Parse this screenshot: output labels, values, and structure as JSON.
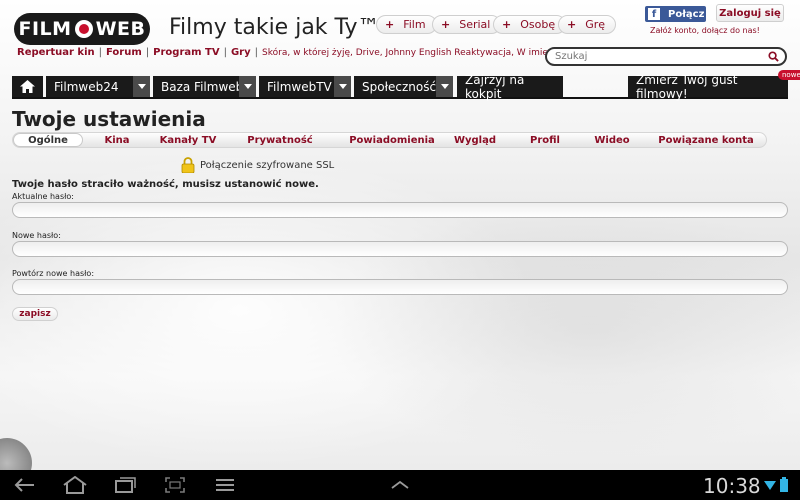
{
  "header": {
    "logo_text_left": "FILM",
    "logo_text_right": "WEB",
    "tagline": "Filmy takie jak Ty™",
    "add_buttons": [
      "Film",
      "Serial",
      "Osobę",
      "Grę"
    ],
    "facebook_label": "Połącz",
    "login_label": "Zaloguj się",
    "register_text": "Załóż konto, dołącz do nas!"
  },
  "quicklinks": {
    "items": [
      "Repertuar kin",
      "Forum",
      "Program TV",
      "Gry"
    ],
    "news": "Skóra, w której żyję, Drive, Johnny English Reaktywacja, W imieniu diabł..."
  },
  "search": {
    "placeholder": "Szukaj"
  },
  "nav": {
    "items": [
      "Filmweb24",
      "Baza Filmwebu",
      "FilmwebTV",
      "Społeczność",
      "Zajrzyj na kokpit"
    ],
    "promo": "Zmierz Twój gust filmowy!",
    "promo_badge": "nowe"
  },
  "settings": {
    "title": "Twoje ustawienia",
    "tabs": [
      "Ogólne",
      "Kina",
      "Kanały TV",
      "Prywatność",
      "Powiadomienia",
      "Wygląd",
      "Profil",
      "Wideo",
      "Powiązane konta"
    ],
    "active_tab": "Ogólne",
    "ssl_text": "Połączenie szyfrowane SSL",
    "warning": "Twoje hasło straciło ważność, musisz ustanowić nowe.",
    "fields": [
      {
        "label": "Aktualne hasło:",
        "value": ""
      },
      {
        "label": "Nowe hasło:",
        "value": ""
      },
      {
        "label": "Powtórz nowe hasło:",
        "value": ""
      }
    ],
    "save_label": "zapisz"
  },
  "system_bar": {
    "time": "10:38"
  },
  "colors": {
    "brand_red": "#8b0d25",
    "nav_dark": "#1a1a1a",
    "facebook_blue": "#3b5998"
  }
}
